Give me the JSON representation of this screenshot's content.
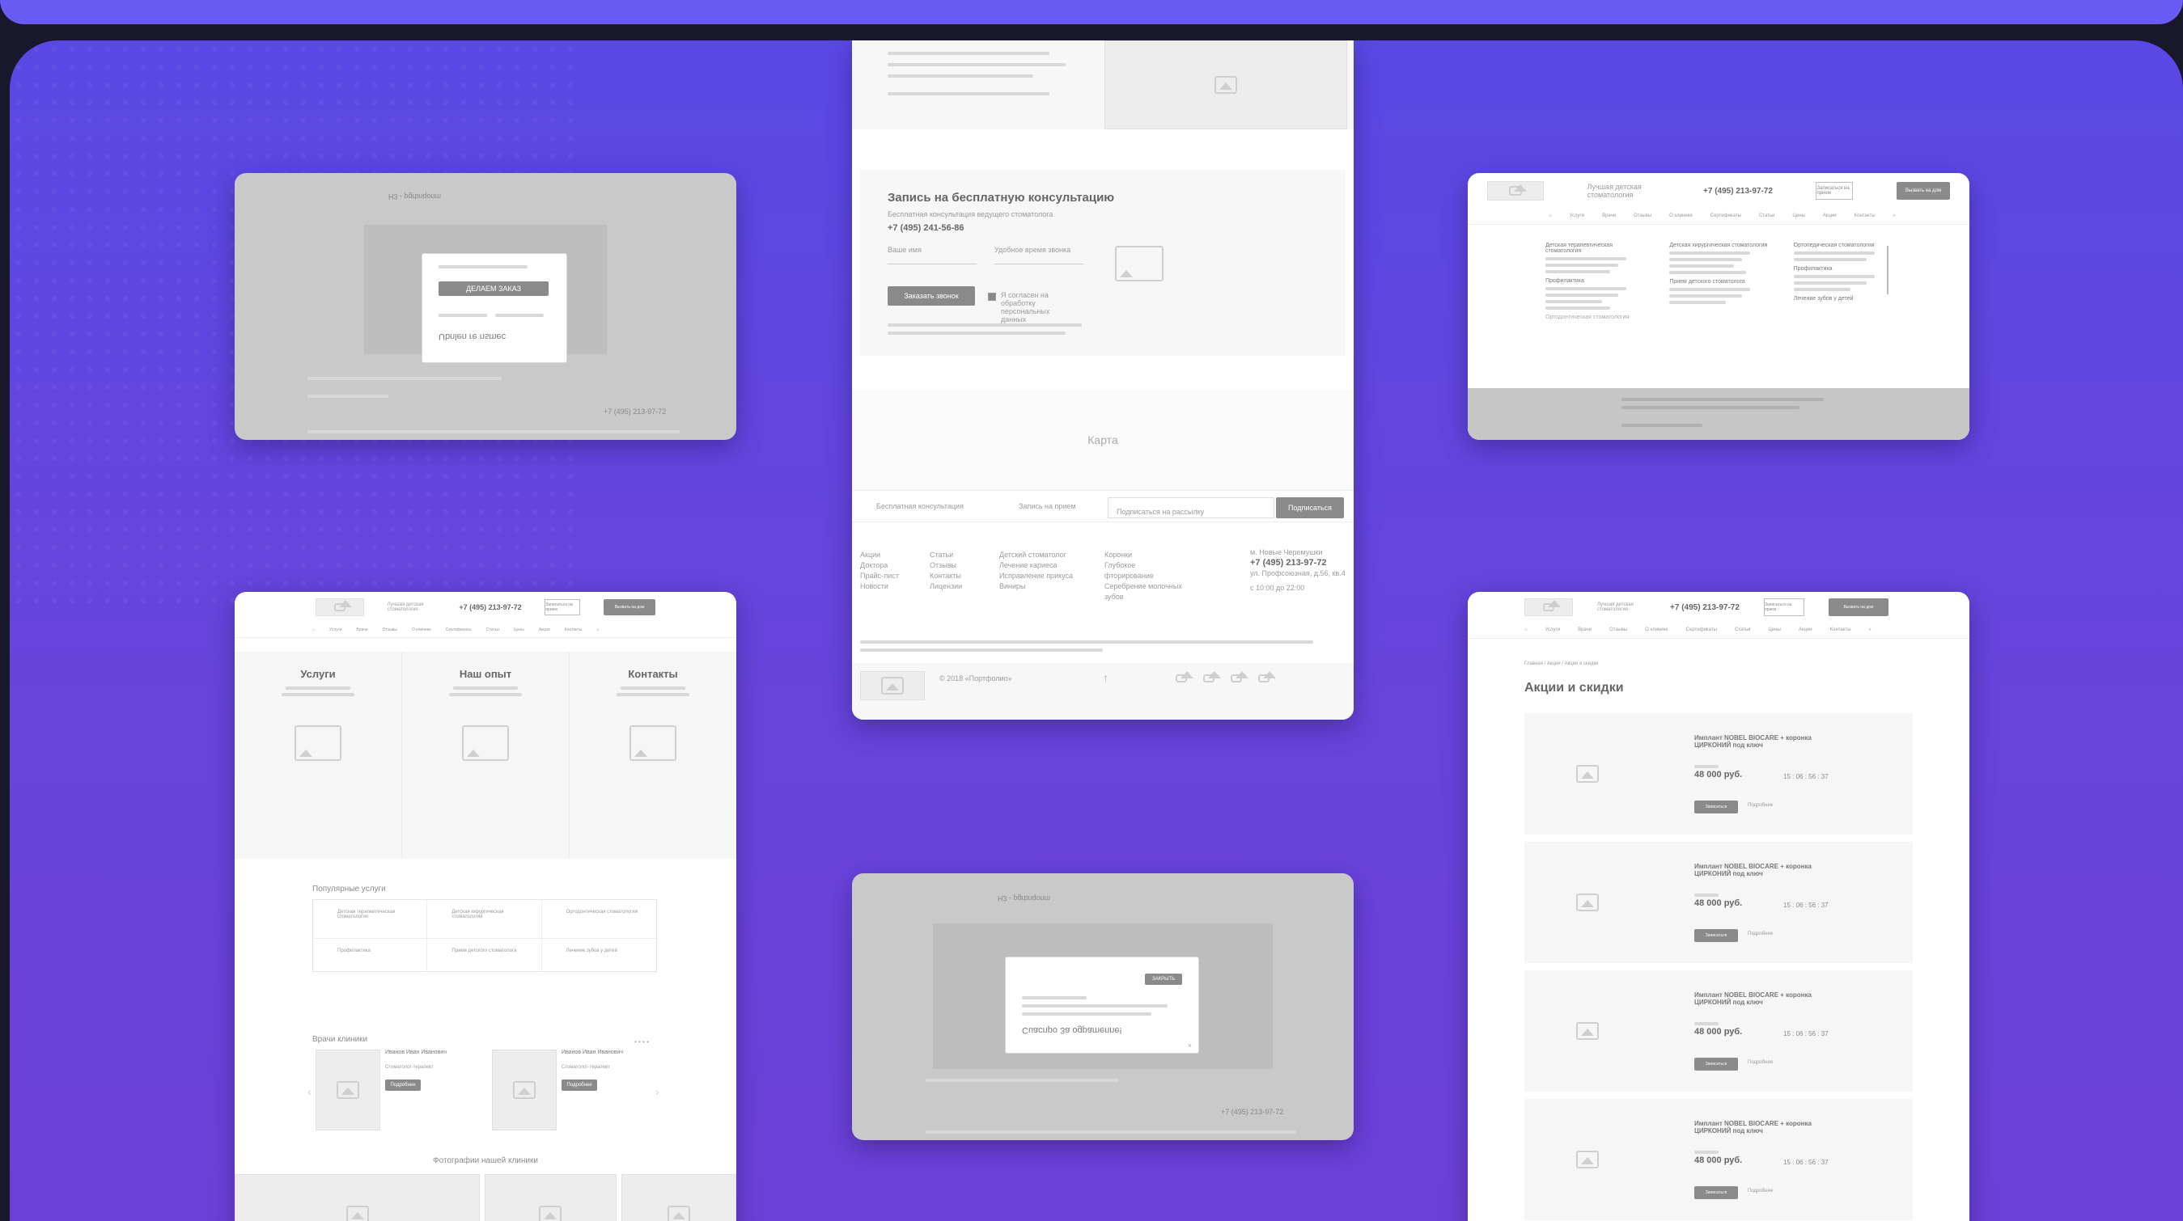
{
  "theme": {
    "accent": "#6a5bf2",
    "background": "#5a48e4",
    "wireframe_gray": "#c9c9c9"
  },
  "card_mc1": {
    "logo": "H3 - pgrbnqonm",
    "modal_title": "Ubnlen re nsmec",
    "modal_button": "ДЕЛАЕМ ЗАКАЗ",
    "footer_phone": "+7 (495) 213-97-72"
  },
  "card_form": {
    "title": "Запись на бесплатную консультацию",
    "subtitle": "Бесплатная консультация ведущего стоматолога",
    "phone": "+7 (495) 241-56-86",
    "name_label": "Ваше имя",
    "time_label": "Удобное время звонка",
    "submit": "Заказать звонок",
    "consent": "Я согласен на обработку персональных данных",
    "map_label": "Карта",
    "strip_consult": "Бесплатная консультация",
    "strip_appointment": "Запись на прием",
    "subscribe_placeholder": "Подписаться на рассылку",
    "subscribe_button": "Подписаться",
    "footer_cols": [
      [
        "Акции",
        "Доктора",
        "Прайс-лист",
        "Новости"
      ],
      [
        "Статьи",
        "Отзывы",
        "Контакты",
        "Лицензии"
      ],
      [
        "Детский стоматолог",
        "Лечение кариеса",
        "Исправление прикуса",
        "Виниры"
      ],
      [
        "Коронки",
        "Глубокое фторирование",
        "Серебрение молочных зубов"
      ]
    ],
    "footer_address": "м. Новые Черемушки",
    "footer_phone": "+7 (495) 213-97-72",
    "footer_street": "ул. Профсоюзная, д.56, кв.4",
    "footer_hours": "с 10:00 до 22:00",
    "copyright": "© 2018 «Портфолио»"
  },
  "card_menu": {
    "header_text": "Лучшая детская стоматология",
    "phone": "+7 (495) 213-97-72",
    "cta1": "Записаться на прием",
    "cta2": "Вызвать на дом",
    "nav": [
      "Услуги",
      "Врачи",
      "Отзывы",
      "О клинике",
      "Сертификаты",
      "Статьи",
      "Цены",
      "Акции",
      "Контакты"
    ],
    "columns": [
      [
        "Детская терапевтическая стоматология",
        "Профилактика",
        "Ортодонтическая стоматология"
      ],
      [
        "Детская хирургическая стоматология",
        "Прием детского стоматолога"
      ],
      [
        "Ортопедическая стоматология",
        "Профилактика",
        "Лечение зубов у детей"
      ]
    ]
  },
  "card_services": {
    "header_text": "Лучшая детская стоматология",
    "phone": "+7 (495) 213-97-72",
    "cta1": "Записаться на прием",
    "cta2": "Вызвать на дом",
    "nav": [
      "Услуги",
      "Врачи",
      "Отзывы",
      "О клинике",
      "Сертификаты",
      "Статьи",
      "Цены",
      "Акции",
      "Контакты"
    ],
    "panels": [
      "Услуги",
      "Наш опыт",
      "Контакты"
    ],
    "popular_title": "Популярные услуги",
    "services": [
      "Детская терапевтическая стоматология",
      "Детская хирургическая стоматология",
      "Ортодонтическая стоматология",
      "Профилактика",
      "Прием детского стоматолога",
      "Лечение зубов у детей"
    ],
    "doctors_title": "Врачи клиники",
    "doctor_name": "Иванов Иван Иванович",
    "doctor_role": "Стоматолог-терапевт",
    "doctor_button": "Подробнее",
    "photos_title": "Фотографии нашей клиники"
  },
  "card_mc2": {
    "logo": "H3 - pgrbnqonm",
    "modal_title": "Cuacnpo 3a ogpamenne!",
    "modal_button": "ЗАКРЫТЬ",
    "footer_phone": "+7 (495) 213-97-72"
  },
  "card_promo": {
    "header_text": "Лучшая детская стоматология",
    "phone": "+7 (495) 213-97-72",
    "cta1": "Записаться на прием",
    "cta2": "Вызвать на дом",
    "nav": [
      "Услуги",
      "Врачи",
      "Отзывы",
      "О клинике",
      "Сертификаты",
      "Статьи",
      "Цены",
      "Акции",
      "Контакты"
    ],
    "breadcrumb": "Главная / Акции / Акции и скидки",
    "title": "Акции и скидки",
    "items": [
      {
        "name": "Имплант NOBEL BIOCARE + коронка ЦИРКОНИЙ под ключ",
        "price": "48 000 руб.",
        "timer": "15 : 06 : 56 : 37"
      },
      {
        "name": "Имплант NOBEL BIOCARE + коронка ЦИРКОНИЙ под ключ",
        "price": "48 000 руб.",
        "timer": "15 : 06 : 56 : 37"
      },
      {
        "name": "Имплант NOBEL BIOCARE + коронка ЦИРКОНИЙ под ключ",
        "price": "48 000 руб.",
        "timer": "15 : 06 : 56 : 37"
      },
      {
        "name": "Имплант NOBEL BIOCARE + коронка ЦИРКОНИЙ под ключ",
        "price": "48 000 руб.",
        "timer": "15 : 06 : 56 : 37"
      }
    ],
    "signup_label": "Записаться",
    "details_label": "Подробнее"
  }
}
